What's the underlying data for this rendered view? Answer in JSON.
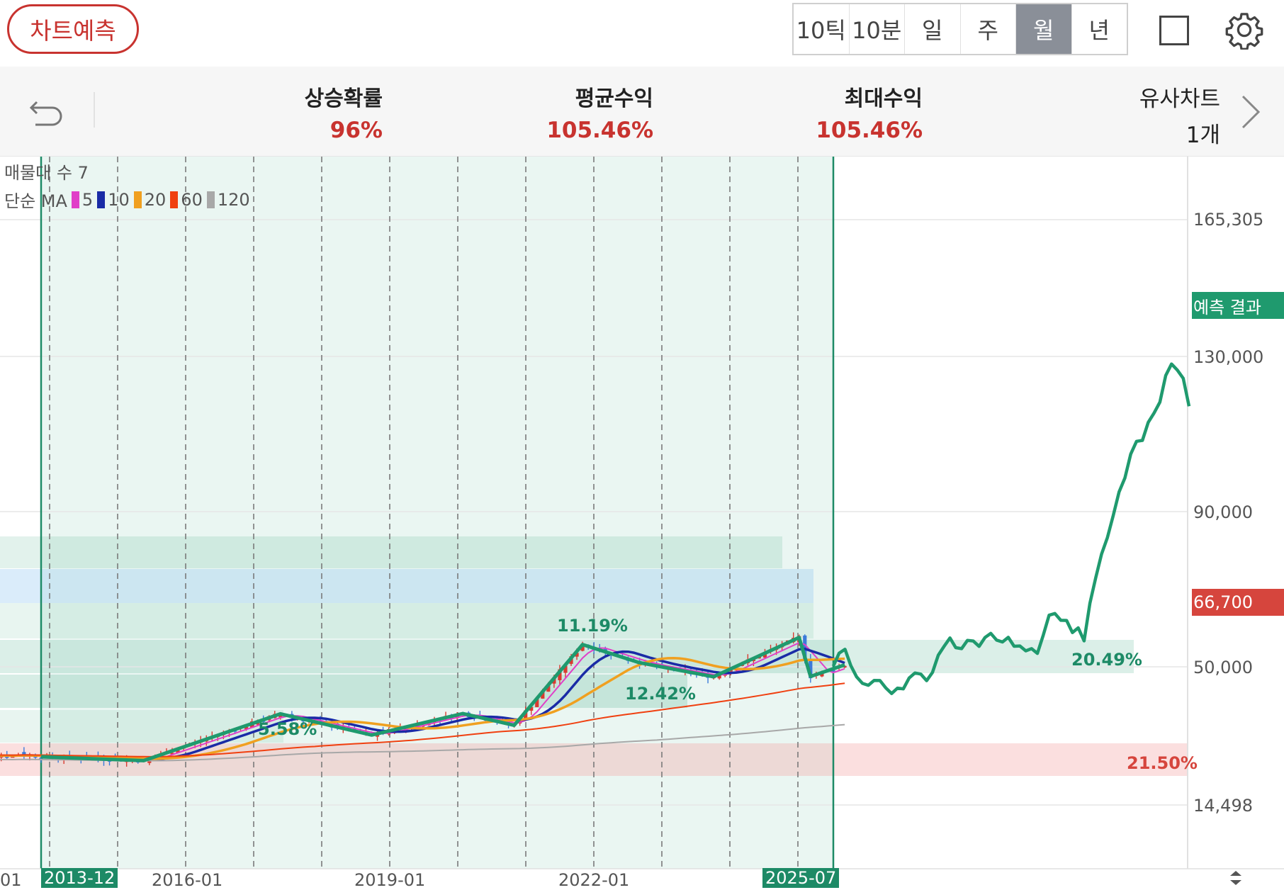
{
  "header": {
    "title_button": "차트예측",
    "periods": [
      "10틱",
      "10분",
      "일",
      "주",
      "월",
      "년"
    ],
    "active_period": "월"
  },
  "stats": {
    "rise_prob_label": "상승확률",
    "rise_prob_value": "96%",
    "avg_return_label": "평균수익",
    "avg_return_value": "105.46%",
    "max_return_label": "최대수익",
    "max_return_value": "105.46%",
    "similar_label": "유사차트",
    "similar_count": "1개"
  },
  "legend": {
    "volume_profile": "매물대 수 7",
    "ma_type": "단순 MA",
    "ma_periods": [
      {
        "label": "5",
        "color": "#e040c8"
      },
      {
        "label": "10",
        "color": "#1a2ba6"
      },
      {
        "label": "20",
        "color": "#f0a020"
      },
      {
        "label": "60",
        "color": "#f04010"
      },
      {
        "label": "120",
        "color": "#a8a8a8"
      }
    ]
  },
  "chart_data": {
    "type": "line",
    "y_ticks": [
      "165,305",
      "130,000",
      "90,000",
      "50,000",
      "14,498"
    ],
    "current_price_label": "66,700",
    "forecast_label": "예측 결과",
    "x_ticks": [
      "01",
      "2013-12",
      "2016-01",
      "2019-01",
      "2022-01",
      "2025-07"
    ],
    "highlight_start": "2013-12",
    "highlight_end": "2025-07",
    "zone_percentages": [
      "20.49%",
      "21.50%",
      "12.42%",
      "11.19%",
      "5.58%"
    ],
    "colors": {
      "forecast": "#1f9a6e",
      "up_candle": "#d93a30",
      "down_candle": "#3b7ad9",
      "price_box": "#d6453d",
      "forecast_box": "#1f9a6e"
    },
    "pattern_pivots_percent": [
      [
        "2013-12",
        3
      ],
      [
        "2015-06",
        0.6
      ],
      [
        "2017-06",
        30.2
      ],
      [
        "2018-10",
        16.8
      ],
      [
        "2020-02",
        30.4
      ],
      [
        "2020-11",
        23.0
      ],
      [
        "2021-11",
        74.0
      ],
      [
        "2022-09",
        62.6
      ],
      [
        "2023-10",
        53.7
      ],
      [
        "2025-01",
        78.4
      ],
      [
        "2025-03",
        53.9
      ],
      [
        "2025-09",
        61.2
      ]
    ],
    "forecast_path_percent": [
      [
        0,
        60.4
      ],
      [
        1,
        68.6
      ],
      [
        2,
        71.0
      ],
      [
        3,
        60.7
      ],
      [
        4,
        53.6
      ],
      [
        5,
        49.5
      ],
      [
        6,
        48.3
      ],
      [
        7,
        51.4
      ],
      [
        8,
        51.3
      ],
      [
        9,
        46.6
      ],
      [
        10,
        43.1
      ],
      [
        11,
        46.5
      ],
      [
        12,
        46.0
      ],
      [
        13,
        52.9
      ],
      [
        14,
        56.1
      ],
      [
        15,
        55.4
      ],
      [
        16,
        51.2
      ],
      [
        17,
        56.4
      ],
      [
        18,
        67.3
      ],
      [
        19,
        72.9
      ],
      [
        20,
        78.1
      ],
      [
        21,
        72.0
      ],
      [
        22,
        71.4
      ],
      [
        23,
        76.6
      ],
      [
        24,
        76.2
      ],
      [
        25,
        72.8
      ],
      [
        26,
        78.4
      ],
      [
        27,
        81.0
      ],
      [
        28,
        76.8
      ],
      [
        29,
        75.6
      ],
      [
        30,
        78.5
      ],
      [
        31,
        72.9
      ],
      [
        32,
        73.1
      ],
      [
        33,
        70.0
      ],
      [
        34,
        71.4
      ],
      [
        35,
        68.4
      ],
      [
        36,
        79.9
      ],
      [
        37,
        92.4
      ],
      [
        38,
        93.5
      ],
      [
        39,
        89.2
      ],
      [
        40,
        89.1
      ],
      [
        41,
        81.5
      ],
      [
        42,
        84.5
      ],
      [
        43,
        76.3
      ],
      [
        44,
        99.9
      ],
      [
        45,
        115.9
      ],
      [
        46,
        130.9
      ],
      [
        47,
        141.2
      ],
      [
        48,
        155.0
      ],
      [
        49,
        170.1
      ],
      [
        50,
        179.2
      ],
      [
        51,
        194.6
      ],
      [
        52,
        202.8
      ],
      [
        53,
        203.4
      ],
      [
        54,
        215.0
      ],
      [
        55,
        221.0
      ],
      [
        56,
        228.1
      ],
      [
        57,
        245.2
      ],
      [
        58,
        252.6
      ],
      [
        59,
        248.7
      ],
      [
        60,
        243.4
      ],
      [
        61,
        225.4
      ]
    ]
  }
}
